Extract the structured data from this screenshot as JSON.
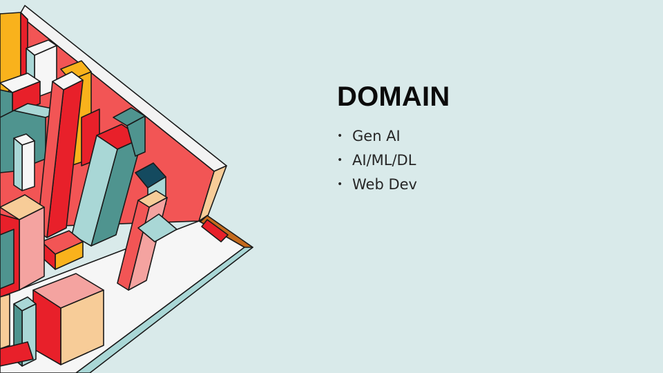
{
  "slide": {
    "title": "DOMAIN",
    "bullets": [
      "Gen AI",
      "AI/ML/DL",
      "Web Dev"
    ],
    "bullet_symbol": "•",
    "background_color": "#d9eaea",
    "illustration": "isometric-city-blocks-illustration",
    "palette": {
      "red": "#e8202a",
      "coral": "#f25555",
      "pink": "#f4a3a0",
      "teal": "#4f948f",
      "light_teal": "#a9d7d6",
      "yellow": "#f9b21c",
      "peach": "#f7cc98",
      "brown": "#c46a1d",
      "navy": "#144a5f",
      "white": "#f6f6f6"
    }
  }
}
